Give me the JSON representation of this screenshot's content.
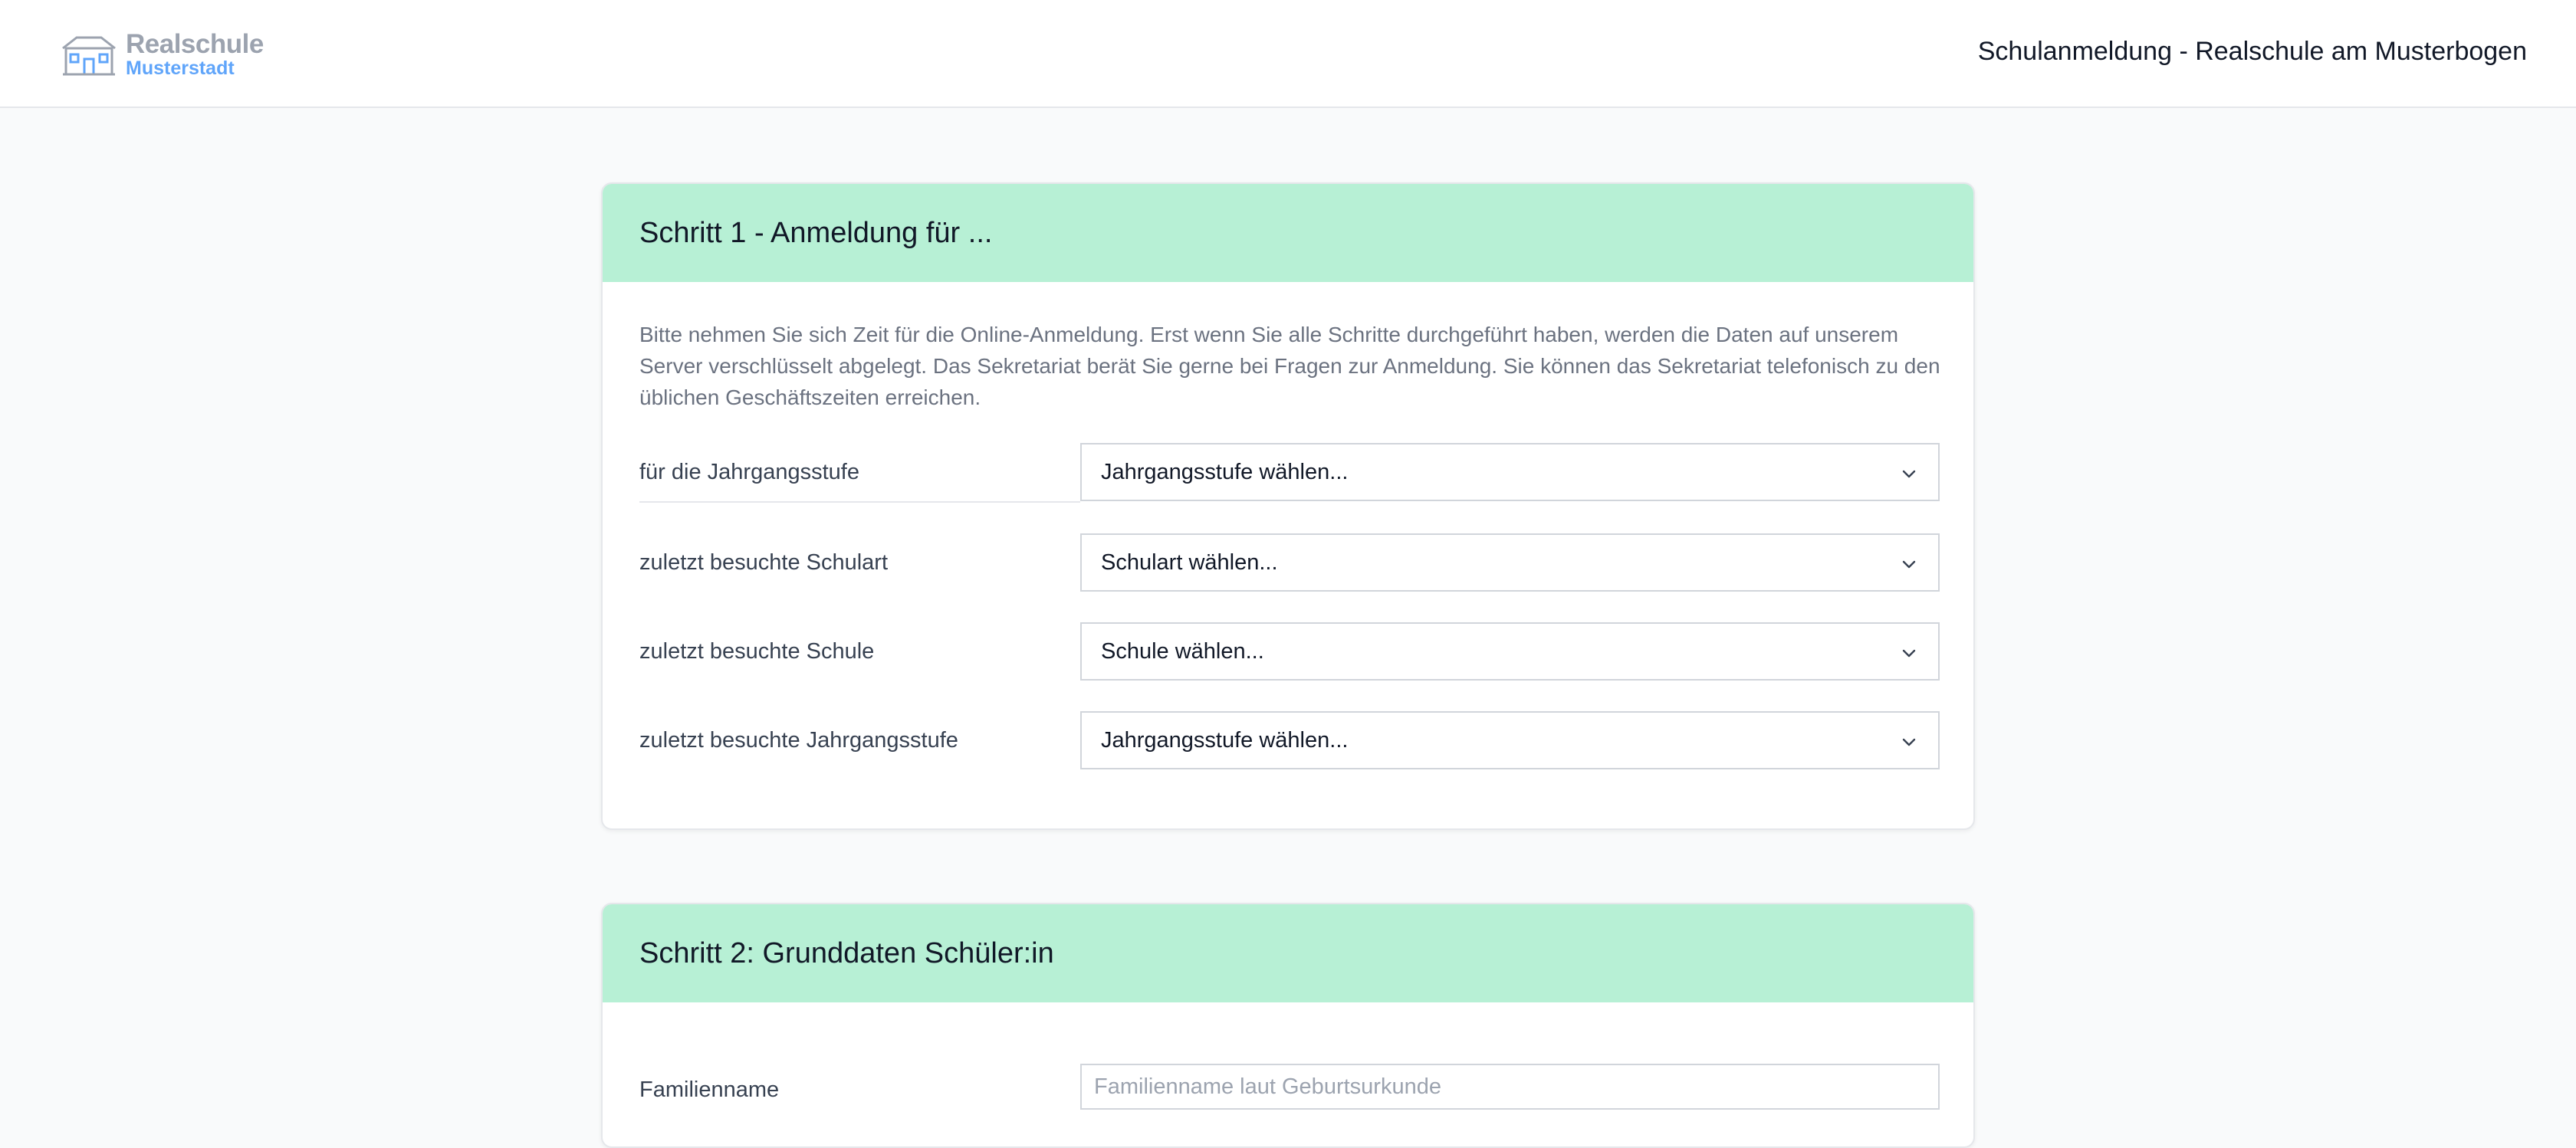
{
  "header": {
    "logo_line1": "Realschule",
    "logo_line2": "Musterstadt",
    "logo_icon": "school-building-icon",
    "title": "Schulanmeldung - Realschule am Musterbogen"
  },
  "step1": {
    "title": "Schritt 1 - Anmeldung für ...",
    "intro": "Bitte nehmen Sie sich Zeit für die Online-Anmeldung. Erst wenn Sie alle Schritte durchgeführt haben, werden die Daten auf unserem Server verschlüsselt abgelegt. Das Sekretariat berät Sie gerne bei Fragen zur Anmeldung. Sie können das Sekretariat telefonisch zu den üblichen Geschäftszeiten erreichen.",
    "fields": [
      {
        "label": "für die Jahrgangsstufe",
        "value": "Jahrgangsstufe wählen..."
      },
      {
        "label": "zuletzt besuchte Schulart",
        "value": "Schulart wählen..."
      },
      {
        "label": "zuletzt besuchte Schule",
        "value": "Schule wählen..."
      },
      {
        "label": "zuletzt besuchte Jahrgangsstufe",
        "value": "Jahrgangsstufe wählen..."
      }
    ]
  },
  "step2": {
    "title": "Schritt 2: Grunddaten Schüler:in",
    "fields": [
      {
        "label": "Familienname",
        "value": "",
        "placeholder": "Familienname laut Geburtsurkunde"
      }
    ]
  },
  "colors": {
    "card_header": "#b7f0d5",
    "logo_gray": "#9ca3af",
    "logo_blue": "#60a5fa",
    "page_bg": "#f9fafb"
  }
}
